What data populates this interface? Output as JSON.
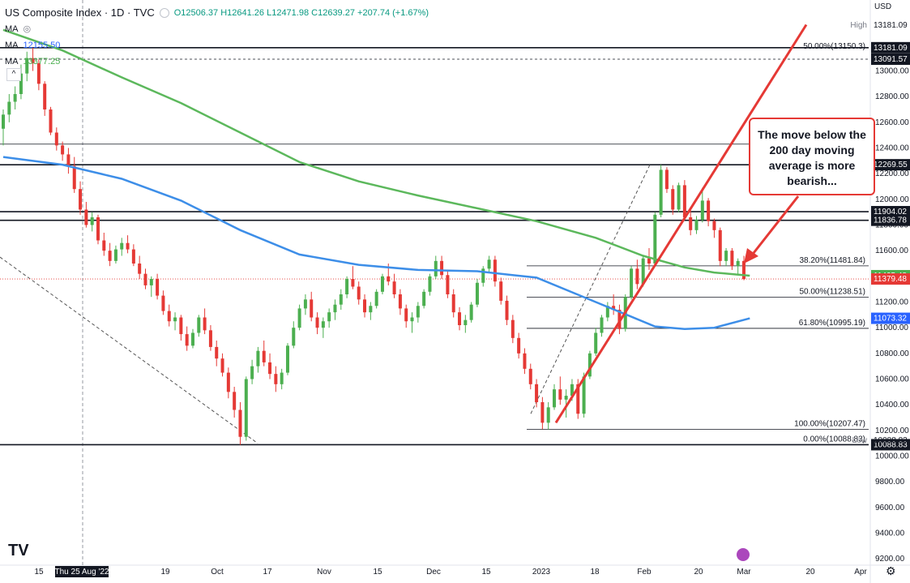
{
  "header": {
    "title": "US Composite Index · 1D · TVC",
    "ohlc": "O12506.37 H12641.26 L12471.98 C12639.27 +207.74 (+1.67%)",
    "ma1_label": "MA",
    "ma2_label": "MA",
    "ma2_value": "12155.50",
    "ma3_label": "MA",
    "ma3_value": "13377.25",
    "currency": "USD",
    "collapse": "^"
  },
  "colors": {
    "up": "#4caf50",
    "down": "#e53935",
    "ma50": "#3d8ee8",
    "ma200": "#5cb85c",
    "trendline": "#e53935"
  },
  "callout": {
    "text": "The move below the 200 day moving average is more bearish..."
  },
  "chart_data": {
    "type": "candlestick",
    "title": "US Composite Index",
    "y_axis": {
      "min": 9100,
      "max": 13300,
      "ticks": [
        13000,
        12800,
        12600,
        12400,
        12200,
        12000,
        11800,
        11600,
        11400,
        11200,
        11000,
        10800,
        10600,
        10400,
        10200,
        10000,
        9800,
        9600,
        9400,
        9200
      ]
    },
    "x_axis": {
      "ticks": [
        "15",
        "Thu 25 Aug '22",
        "19",
        "Oct",
        "17",
        "Nov",
        "15",
        "Dec",
        "15",
        "2023",
        "18",
        "Feb",
        "20",
        "Mar",
        "20",
        "Apr"
      ]
    },
    "horizontal_levels": [
      {
        "value": 13181.09,
        "label": "13181.09"
      },
      {
        "value": 13091.57,
        "label": "13091.57"
      },
      {
        "value": 12430,
        "label": ""
      },
      {
        "value": 12269.55,
        "label": "12269.55"
      },
      {
        "value": 11904.02,
        "label": "11904.02"
      },
      {
        "value": 11836.78,
        "label": "11836.78"
      },
      {
        "value": 10088.83,
        "label": "10088.83"
      }
    ],
    "fibonacci": [
      {
        "level": "50.00%",
        "value": 13150,
        "label": "50.00%(13150.3)"
      },
      {
        "level": "38.20%",
        "value": 11481.84,
        "label": "38.20%(11481.84)"
      },
      {
        "level": "50.00%",
        "value": 11238.51,
        "label": "50.00%(11238.51)"
      },
      {
        "level": "61.80%",
        "value": 10995.19,
        "label": "61.80%(10995.19)"
      },
      {
        "level": "100.00%",
        "value": 10207.47,
        "label": "100.00%(10207.47)"
      },
      {
        "level": "0.00%",
        "value": 10088.83,
        "label": "0.00%(10088.83)"
      }
    ],
    "price_tags": [
      {
        "label": "High",
        "value": 13181.09,
        "text": "13181.09",
        "style": "plain"
      },
      {
        "value": 13181.09,
        "text": "13181.09",
        "style": "dark"
      },
      {
        "value": 13091.57,
        "text": "13091.57",
        "style": "dark"
      },
      {
        "value": 12269.55,
        "text": "12269.55",
        "style": "dark"
      },
      {
        "value": 11904.02,
        "text": "11904.02",
        "style": "dark"
      },
      {
        "value": 11836.78,
        "text": "11836.78",
        "style": "dark"
      },
      {
        "value": 11405.48,
        "text": "11405.48",
        "style": "green"
      },
      {
        "value": 11379.48,
        "text": "11379.48",
        "style": "red"
      },
      {
        "value": 11073.32,
        "text": "11073.32",
        "style": "blue"
      },
      {
        "value": 10088.83,
        "text": "10088.83",
        "style": "dark"
      },
      {
        "label": "Low",
        "value": 10088.83,
        "text": "10088.83",
        "style": "plain"
      }
    ],
    "last_close": 11379.48,
    "candles": [
      [
        12550,
        12700,
        12420,
        12660
      ],
      [
        12660,
        12820,
        12600,
        12760
      ],
      [
        12760,
        12880,
        12700,
        12820
      ],
      [
        12820,
        13050,
        12780,
        12980
      ],
      [
        12980,
        13150,
        12920,
        13100
      ],
      [
        13100,
        13181,
        13000,
        13060
      ],
      [
        13060,
        13090,
        12850,
        12900
      ],
      [
        12900,
        12920,
        12650,
        12700
      ],
      [
        12700,
        12720,
        12500,
        12520
      ],
      [
        12520,
        12560,
        12380,
        12420
      ],
      [
        12420,
        12450,
        12300,
        12350
      ],
      [
        12350,
        12400,
        12200,
        12260
      ],
      [
        12260,
        12330,
        12050,
        12080
      ],
      [
        12080,
        12140,
        11880,
        11920
      ],
      [
        11920,
        11980,
        11780,
        11800
      ],
      [
        11800,
        11900,
        11750,
        11860
      ],
      [
        11860,
        11880,
        11650,
        11680
      ],
      [
        11680,
        11740,
        11560,
        11600
      ],
      [
        11600,
        11660,
        11480,
        11520
      ],
      [
        11520,
        11640,
        11500,
        11610
      ],
      [
        11610,
        11700,
        11560,
        11660
      ],
      [
        11660,
        11720,
        11580,
        11610
      ],
      [
        11610,
        11650,
        11480,
        11500
      ],
      [
        11500,
        11560,
        11380,
        11420
      ],
      [
        11420,
        11460,
        11300,
        11330
      ],
      [
        11330,
        11400,
        11240,
        11380
      ],
      [
        11380,
        11420,
        11220,
        11250
      ],
      [
        11250,
        11290,
        11100,
        11130
      ],
      [
        11130,
        11180,
        11010,
        11050
      ],
      [
        11050,
        11120,
        10980,
        11080
      ],
      [
        11080,
        11100,
        10900,
        10950
      ],
      [
        10950,
        11010,
        10820,
        10860
      ],
      [
        10860,
        10990,
        10840,
        10960
      ],
      [
        10960,
        11100,
        10930,
        11080
      ],
      [
        11080,
        11150,
        10950,
        10980
      ],
      [
        10980,
        11020,
        10820,
        10850
      ],
      [
        10850,
        10900,
        10700,
        10760
      ],
      [
        10760,
        10800,
        10620,
        10650
      ],
      [
        10650,
        10690,
        10450,
        10500
      ],
      [
        10500,
        10540,
        10300,
        10360
      ],
      [
        10360,
        10420,
        10088,
        10150
      ],
      [
        10150,
        10620,
        10120,
        10600
      ],
      [
        10600,
        10750,
        10560,
        10700
      ],
      [
        10700,
        10850,
        10650,
        10820
      ],
      [
        10820,
        10900,
        10700,
        10730
      ],
      [
        10730,
        10800,
        10600,
        10640
      ],
      [
        10640,
        10700,
        10500,
        10560
      ],
      [
        10560,
        10680,
        10520,
        10650
      ],
      [
        10650,
        10880,
        10630,
        10860
      ],
      [
        10860,
        11050,
        10840,
        11000
      ],
      [
        11000,
        11180,
        10980,
        11150
      ],
      [
        11150,
        11260,
        11100,
        11220
      ],
      [
        11220,
        11280,
        11050,
        11080
      ],
      [
        11080,
        11120,
        10950,
        11000
      ],
      [
        11000,
        11080,
        10920,
        11050
      ],
      [
        11050,
        11150,
        11000,
        11120
      ],
      [
        11120,
        11220,
        11060,
        11180
      ],
      [
        11180,
        11300,
        11140,
        11260
      ],
      [
        11260,
        11400,
        11230,
        11380
      ],
      [
        11380,
        11480,
        11300,
        11320
      ],
      [
        11320,
        11360,
        11180,
        11220
      ],
      [
        11220,
        11260,
        11080,
        11120
      ],
      [
        11120,
        11200,
        11060,
        11170
      ],
      [
        11170,
        11300,
        11150,
        11280
      ],
      [
        11280,
        11420,
        11260,
        11400
      ],
      [
        11400,
        11500,
        11330,
        11360
      ],
      [
        11360,
        11420,
        11230,
        11260
      ],
      [
        11260,
        11300,
        11100,
        11150
      ],
      [
        11150,
        11180,
        11000,
        11050
      ],
      [
        11050,
        11120,
        10960,
        11080
      ],
      [
        11080,
        11200,
        11040,
        11170
      ],
      [
        11170,
        11300,
        11150,
        11280
      ],
      [
        11280,
        11420,
        11250,
        11400
      ],
      [
        11400,
        11560,
        11380,
        11520
      ],
      [
        11520,
        11560,
        11380,
        11410
      ],
      [
        11410,
        11440,
        11230,
        11260
      ],
      [
        11260,
        11300,
        11080,
        11120
      ],
      [
        11120,
        11160,
        10980,
        11020
      ],
      [
        11020,
        11100,
        10960,
        11060
      ],
      [
        11060,
        11200,
        11040,
        11180
      ],
      [
        11180,
        11380,
        11160,
        11350
      ],
      [
        11350,
        11480,
        11320,
        11460
      ],
      [
        11460,
        11560,
        11430,
        11530
      ],
      [
        11530,
        11560,
        11320,
        11360
      ],
      [
        11360,
        11390,
        11180,
        11210
      ],
      [
        11210,
        11250,
        11020,
        11060
      ],
      [
        11060,
        11100,
        10880,
        10920
      ],
      [
        10920,
        10960,
        10760,
        10800
      ],
      [
        10800,
        10840,
        10640,
        10680
      ],
      [
        10680,
        10720,
        10520,
        10560
      ],
      [
        10560,
        10600,
        10380,
        10420
      ],
      [
        10420,
        10460,
        10210,
        10260
      ],
      [
        10260,
        10420,
        10207,
        10380
      ],
      [
        10380,
        10560,
        10360,
        10520
      ],
      [
        10520,
        10620,
        10400,
        10440
      ],
      [
        10440,
        10520,
        10300,
        10470
      ],
      [
        10470,
        10600,
        10430,
        10560
      ],
      [
        10560,
        10600,
        10290,
        10330
      ],
      [
        10330,
        10650,
        10300,
        10620
      ],
      [
        10620,
        10820,
        10600,
        10800
      ],
      [
        10800,
        11000,
        10780,
        10960
      ],
      [
        10960,
        11100,
        10930,
        11080
      ],
      [
        11080,
        11200,
        11050,
        11170
      ],
      [
        11170,
        11260,
        11100,
        11140
      ],
      [
        11140,
        11180,
        10950,
        10990
      ],
      [
        10990,
        11260,
        10970,
        11240
      ],
      [
        11240,
        11480,
        11220,
        11460
      ],
      [
        11460,
        11530,
        11300,
        11340
      ],
      [
        11340,
        11560,
        11320,
        11540
      ],
      [
        11540,
        11620,
        11450,
        11500
      ],
      [
        11500,
        11900,
        11480,
        11880
      ],
      [
        11880,
        12269,
        11860,
        12230
      ],
      [
        12230,
        12250,
        12050,
        12080
      ],
      [
        12080,
        12110,
        11880,
        11920
      ],
      [
        11920,
        12130,
        11900,
        12110
      ],
      [
        12110,
        12150,
        11840,
        11860
      ],
      [
        11860,
        11920,
        11720,
        11760
      ],
      [
        11760,
        11870,
        11730,
        11840
      ],
      [
        11840,
        12090,
        11820,
        11990
      ],
      [
        11990,
        12010,
        11790,
        11830
      ],
      [
        11830,
        11850,
        11700,
        11760
      ],
      [
        11760,
        11780,
        11480,
        11520
      ],
      [
        11520,
        11620,
        11480,
        11600
      ],
      [
        11600,
        11620,
        11450,
        11480
      ],
      [
        11480,
        11540,
        11420,
        11520
      ],
      [
        11520,
        11560,
        11370,
        11379
      ]
    ],
    "series": [
      {
        "name": "",
        "color": "#3d8ee8",
        "points": [
          [
            0,
            12330
          ],
          [
            10,
            12270
          ],
          [
            20,
            12160
          ],
          [
            30,
            11990
          ],
          [
            40,
            11760
          ],
          [
            50,
            11570
          ],
          [
            60,
            11490
          ],
          [
            70,
            11450
          ],
          [
            80,
            11440
          ],
          [
            90,
            11390
          ],
          [
            100,
            11200
          ],
          [
            110,
            11010
          ],
          [
            115,
            10990
          ],
          [
            120,
            11000
          ],
          [
            126,
            11073
          ]
        ]
      },
      {
        "name": "",
        "color": "#5cb85c",
        "points": [
          [
            0,
            13320
          ],
          [
            10,
            13160
          ],
          [
            20,
            12950
          ],
          [
            30,
            12750
          ],
          [
            40,
            12520
          ],
          [
            50,
            12290
          ],
          [
            60,
            12140
          ],
          [
            70,
            12030
          ],
          [
            80,
            11930
          ],
          [
            90,
            11830
          ],
          [
            100,
            11700
          ],
          [
            108,
            11560
          ],
          [
            115,
            11470
          ],
          [
            120,
            11430
          ],
          [
            126,
            11405
          ]
        ]
      }
    ]
  }
}
